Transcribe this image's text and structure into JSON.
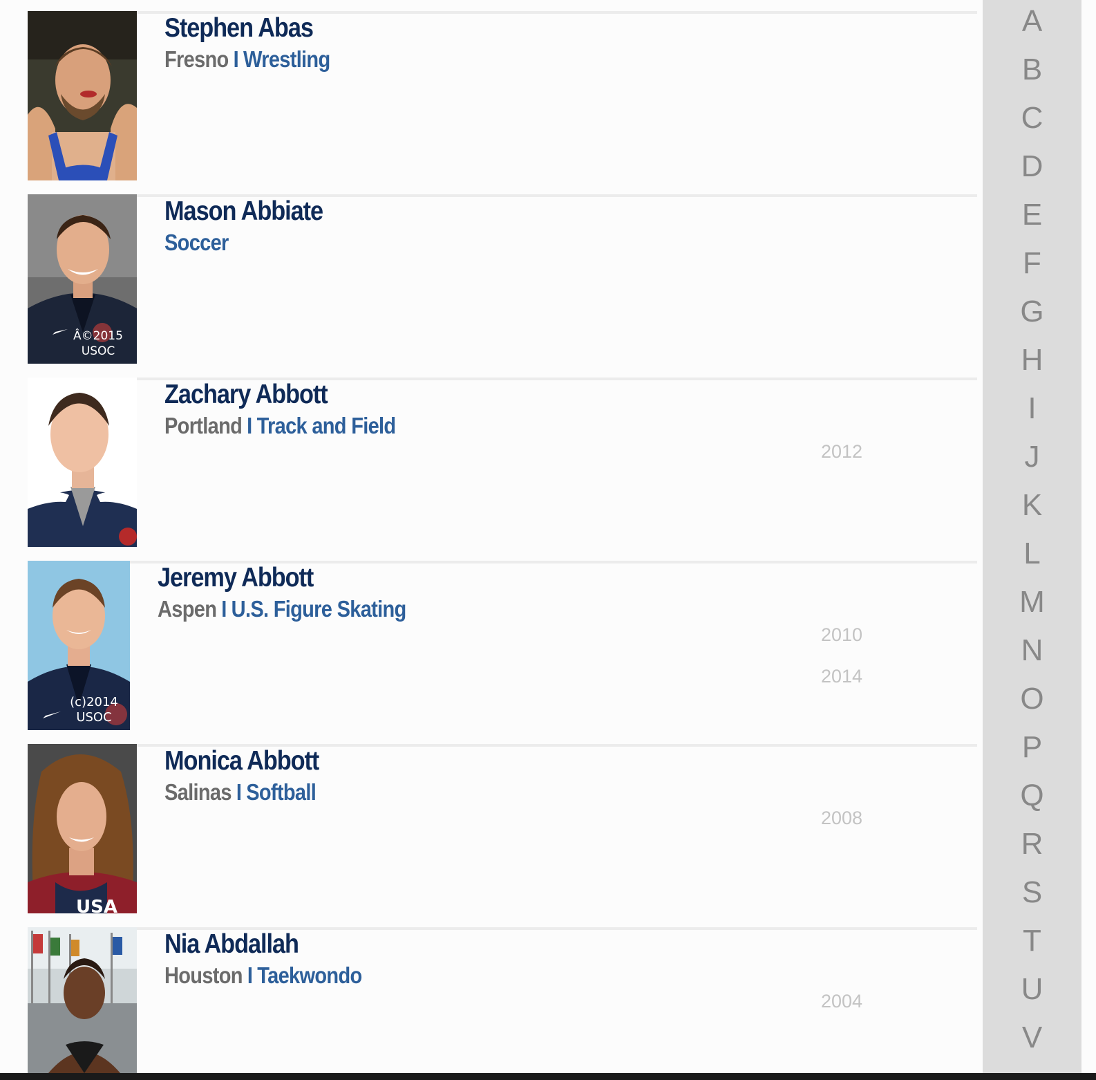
{
  "athletes": [
    {
      "name": "Stephen Abas",
      "city": "Fresno",
      "separator": "I",
      "sport": "Wrestling",
      "years": []
    },
    {
      "name": "Mason Abbiate",
      "city": "",
      "separator": "",
      "sport": "Soccer",
      "years": [],
      "photo_watermark": [
        "Â©2015",
        "USOC"
      ]
    },
    {
      "name": "Zachary Abbott",
      "city": "Portland",
      "separator": "I",
      "sport": "Track and Field",
      "years": [
        "2012"
      ]
    },
    {
      "name": "Jeremy Abbott",
      "city": "Aspen",
      "separator": "I",
      "sport": "U.S. Figure Skating",
      "years": [
        "2010",
        "2014"
      ],
      "photo_watermark": [
        "(c)2014",
        "USOC"
      ]
    },
    {
      "name": "Monica Abbott",
      "city": "Salinas",
      "separator": "I",
      "sport": "Softball",
      "years": [
        "2008"
      ],
      "photo_watermark": [
        "USA"
      ]
    },
    {
      "name": "Nia Abdallah",
      "city": "Houston",
      "separator": "I",
      "sport": "Taekwondo",
      "years": [
        "2004"
      ]
    }
  ],
  "alphabet": [
    "A",
    "B",
    "C",
    "D",
    "E",
    "F",
    "G",
    "H",
    "I",
    "J",
    "K",
    "L",
    "M",
    "N",
    "O",
    "P",
    "Q",
    "R",
    "S",
    "T",
    "U",
    "V"
  ],
  "colors": {
    "name": "#0f2a57",
    "sport": "#2d5f9a",
    "city": "#6b6b6b",
    "year": "#c3c3c3",
    "alpha_bg": "#dcdcdc",
    "alpha_text": "#888888"
  }
}
